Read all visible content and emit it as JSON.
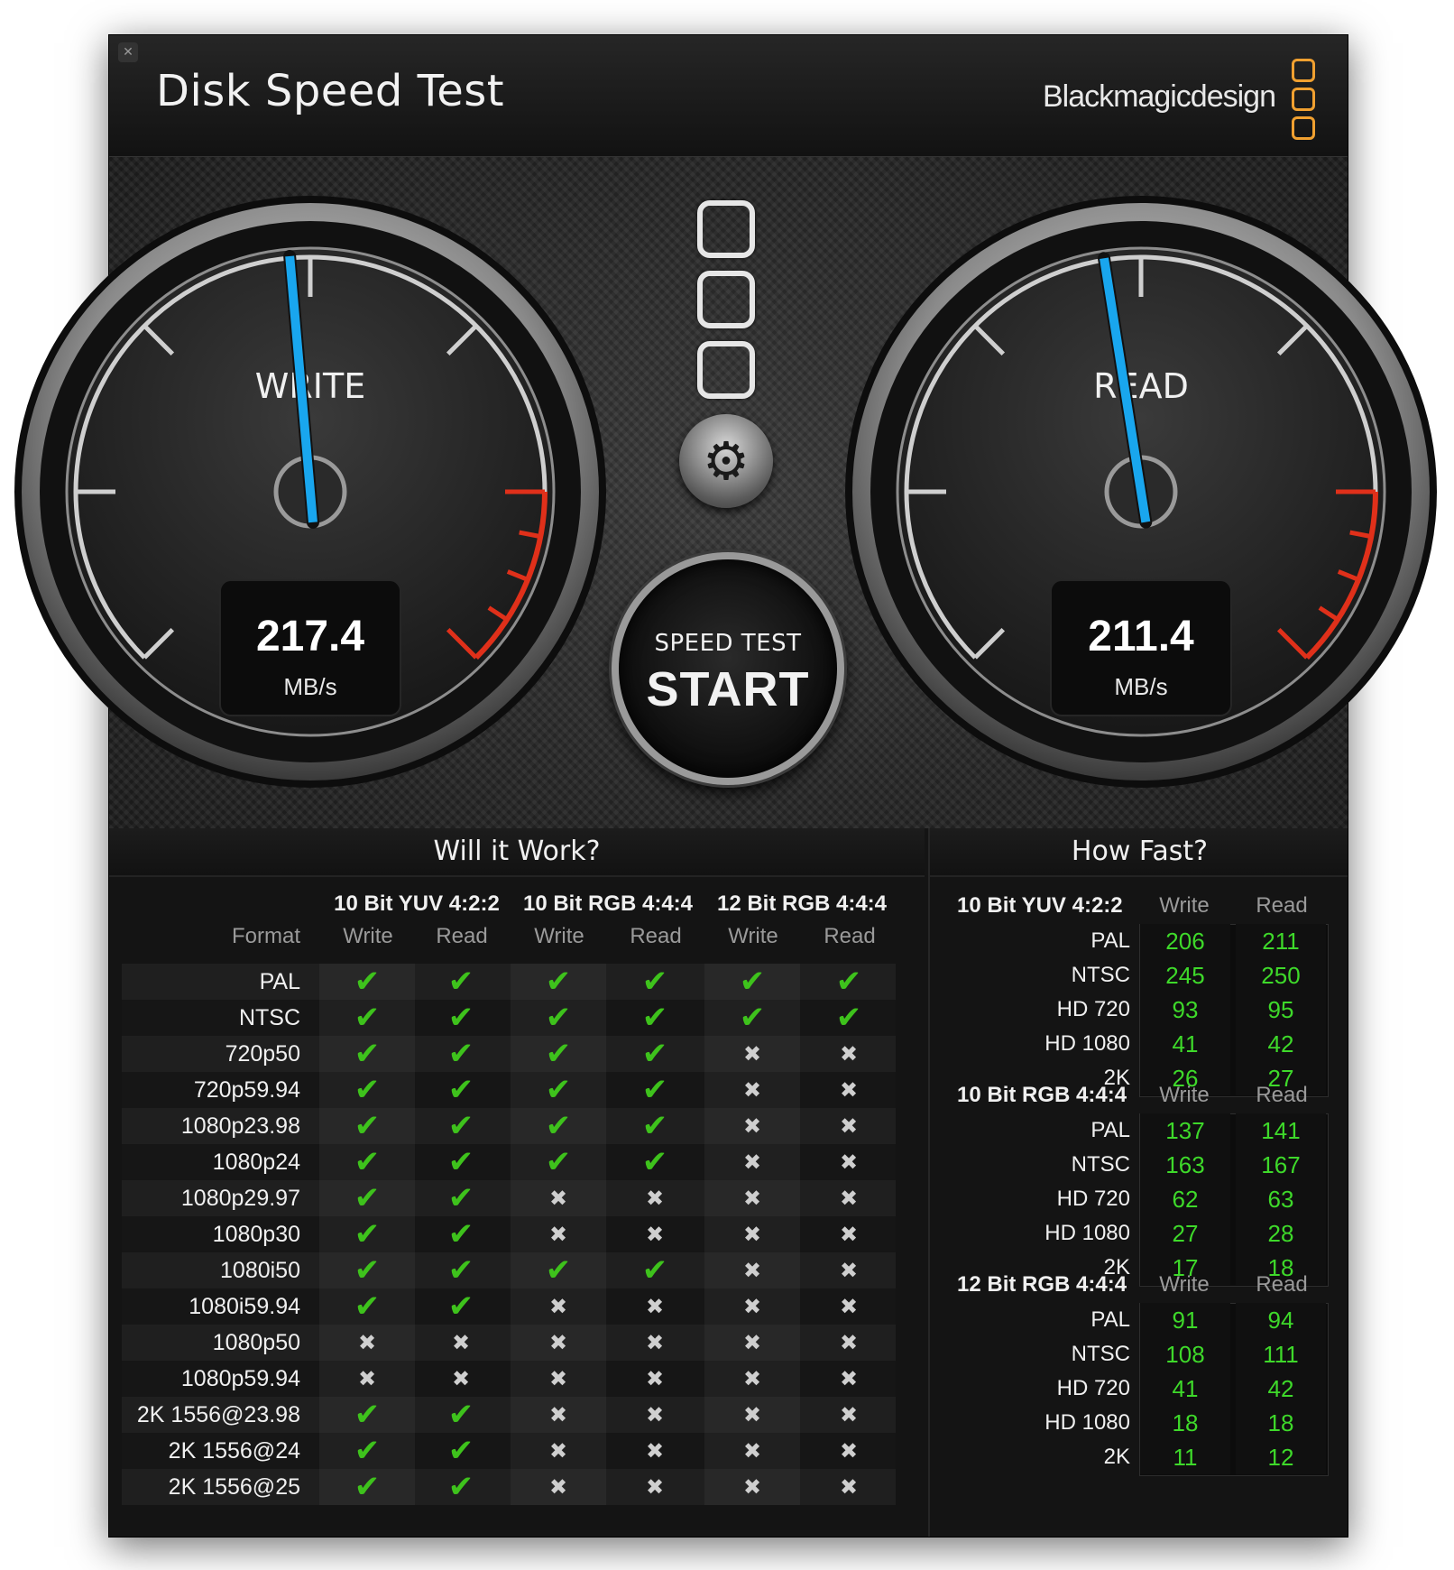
{
  "window": {
    "title": "Disk Speed Test",
    "brand": "Blackmagicdesign",
    "close_glyph": "✕"
  },
  "gauges": {
    "write": {
      "label": "WRITE",
      "value": "217.4",
      "unit": "MB/s"
    },
    "read": {
      "label": "READ",
      "value": "211.4",
      "unit": "MB/s"
    }
  },
  "controls": {
    "settings_icon": "gear-icon",
    "start_small": "SPEED TEST",
    "start_big": "START"
  },
  "will_it_work": {
    "title": "Will it Work?",
    "format_header": "Format",
    "groups": [
      "10 Bit YUV 4:2:2",
      "10 Bit RGB 4:4:4",
      "12 Bit RGB 4:4:4"
    ],
    "sub_headers": [
      "Write",
      "Read",
      "Write",
      "Read",
      "Write",
      "Read"
    ],
    "rows": [
      {
        "format": "PAL",
        "cells": [
          1,
          1,
          1,
          1,
          1,
          1
        ]
      },
      {
        "format": "NTSC",
        "cells": [
          1,
          1,
          1,
          1,
          1,
          1
        ]
      },
      {
        "format": "720p50",
        "cells": [
          1,
          1,
          1,
          1,
          0,
          0
        ]
      },
      {
        "format": "720p59.94",
        "cells": [
          1,
          1,
          1,
          1,
          0,
          0
        ]
      },
      {
        "format": "1080p23.98",
        "cells": [
          1,
          1,
          1,
          1,
          0,
          0
        ]
      },
      {
        "format": "1080p24",
        "cells": [
          1,
          1,
          1,
          1,
          0,
          0
        ]
      },
      {
        "format": "1080p29.97",
        "cells": [
          1,
          1,
          0,
          0,
          0,
          0
        ]
      },
      {
        "format": "1080p30",
        "cells": [
          1,
          1,
          0,
          0,
          0,
          0
        ]
      },
      {
        "format": "1080i50",
        "cells": [
          1,
          1,
          1,
          1,
          0,
          0
        ]
      },
      {
        "format": "1080i59.94",
        "cells": [
          1,
          1,
          0,
          0,
          0,
          0
        ]
      },
      {
        "format": "1080p50",
        "cells": [
          0,
          0,
          0,
          0,
          0,
          0
        ]
      },
      {
        "format": "1080p59.94",
        "cells": [
          0,
          0,
          0,
          0,
          0,
          0
        ]
      },
      {
        "format": "2K 1556@23.98",
        "cells": [
          1,
          1,
          0,
          0,
          0,
          0
        ]
      },
      {
        "format": "2K 1556@24",
        "cells": [
          1,
          1,
          0,
          0,
          0,
          0
        ]
      },
      {
        "format": "2K 1556@25",
        "cells": [
          1,
          1,
          0,
          0,
          0,
          0
        ]
      }
    ],
    "ok_glyph": "✔",
    "no_glyph": "✖"
  },
  "how_fast": {
    "title": "How Fast?",
    "write_header": "Write",
    "read_header": "Read",
    "groups": [
      {
        "name": "10 Bit YUV 4:2:2",
        "rows": [
          {
            "label": "PAL",
            "write": "206",
            "read": "211"
          },
          {
            "label": "NTSC",
            "write": "245",
            "read": "250"
          },
          {
            "label": "HD 720",
            "write": "93",
            "read": "95"
          },
          {
            "label": "HD 1080",
            "write": "41",
            "read": "42"
          },
          {
            "label": "2K",
            "write": "26",
            "read": "27"
          }
        ]
      },
      {
        "name": "10 Bit RGB 4:4:4",
        "rows": [
          {
            "label": "PAL",
            "write": "137",
            "read": "141"
          },
          {
            "label": "NTSC",
            "write": "163",
            "read": "167"
          },
          {
            "label": "HD 720",
            "write": "62",
            "read": "63"
          },
          {
            "label": "HD 1080",
            "write": "27",
            "read": "28"
          },
          {
            "label": "2K",
            "write": "17",
            "read": "18"
          }
        ]
      },
      {
        "name": "12 Bit RGB 4:4:4",
        "rows": [
          {
            "label": "PAL",
            "write": "91",
            "read": "94"
          },
          {
            "label": "NTSC",
            "write": "108",
            "read": "111"
          },
          {
            "label": "HD 720",
            "write": "41",
            "read": "42"
          },
          {
            "label": "HD 1080",
            "write": "18",
            "read": "18"
          },
          {
            "label": "2K",
            "write": "11",
            "read": "12"
          }
        ]
      }
    ]
  },
  "colors": {
    "accent_orange": "#f0a030",
    "needle_blue": "#19a6ee",
    "ok_green": "#3ec21c",
    "redline": "#e0301a"
  }
}
